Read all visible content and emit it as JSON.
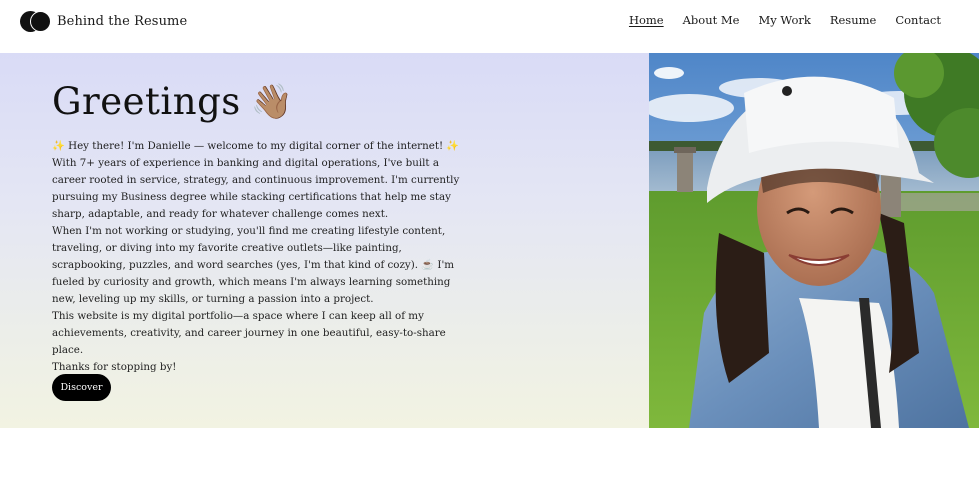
{
  "site": {
    "name": "Behind the Resume"
  },
  "nav": {
    "items": [
      "Home",
      "About Me",
      "My Work",
      "Resume",
      "Contact"
    ],
    "active": "Home"
  },
  "hero": {
    "title": "Greetings",
    "wave_emoji": "👋🏽",
    "paragraphs": [
      "✨ Hey there! I'm Danielle — welcome to my digital corner of the internet! ✨",
      "With 7+ years of experience in banking and digital operations, I've built a career rooted in service, strategy, and continuous improvement. I'm currently pursuing my Business degree while stacking certifications that help me stay sharp, adaptable, and ready for whatever challenge comes next.",
      "When I'm not working or studying, you'll find me creating lifestyle content, traveling, or diving into my favorite creative outlets—like painting, scrapbooking, puzzles, and word searches (yes, I'm that kind of cozy). ☕ I'm fueled by curiosity and growth, which means I'm always learning something new, leveling up my skills, or turning a passion into a project.",
      "This website is my digital portfolio—a space where I can keep all of my achievements, creativity, and career journey in one beautiful, easy-to-share place.",
      "Thanks for stopping by!"
    ],
    "cta_label": "Discover"
  },
  "colors": {
    "hero_top": "#d9dbf6",
    "hero_bottom": "#f2f3e2",
    "button_bg": "#000000",
    "button_text": "#ffffff"
  }
}
